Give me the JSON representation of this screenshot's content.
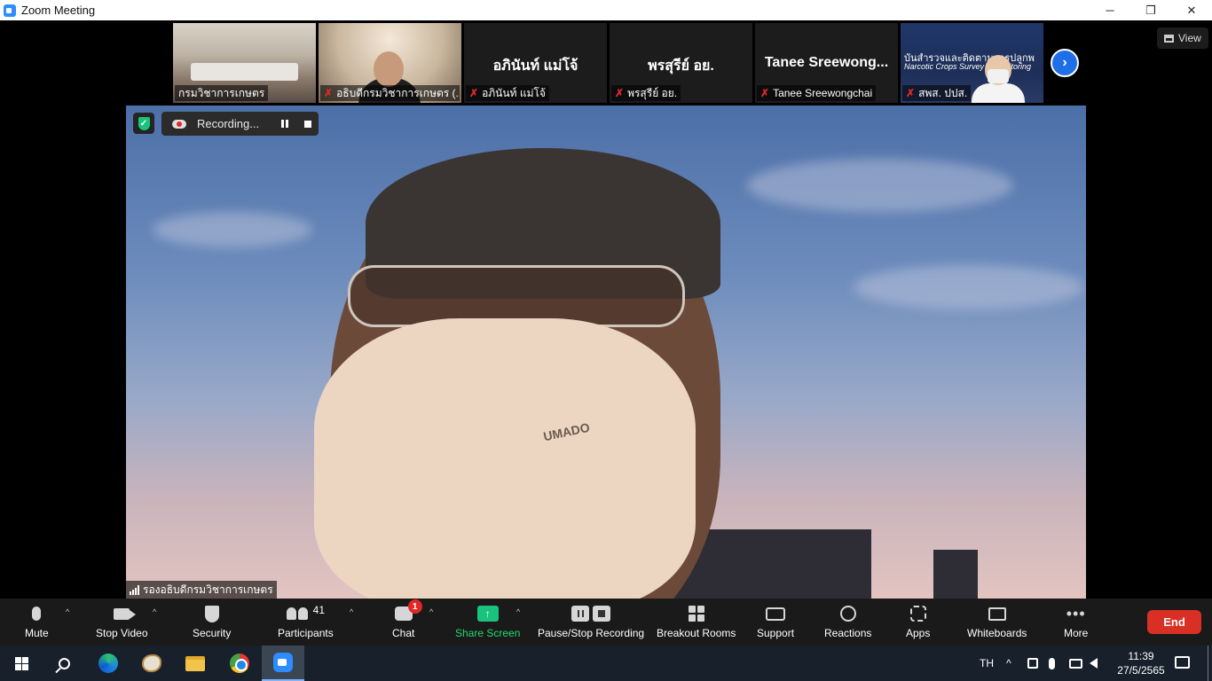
{
  "window": {
    "title": "Zoom Meeting",
    "controls": {
      "minimize": "─",
      "restore": "❐",
      "close": "✕"
    }
  },
  "top": {
    "view_label": "View",
    "participants_strip": [
      {
        "name": "กรมวิชาการเกษตร",
        "muted": false,
        "kind": "video-room"
      },
      {
        "name": "อธิบดีกรมวิชาการเกษตร (...",
        "muted": true,
        "kind": "video-person"
      },
      {
        "display": "อภินันท์ แม่โจ้",
        "name": "อภินันท์ แม่โจ้",
        "muted": true,
        "kind": "name-only"
      },
      {
        "display": "พรสุรีย์ อย.",
        "name": "พรสุรีย์ อย.",
        "muted": true,
        "kind": "name-only"
      },
      {
        "display": "Tanee  Sreewong...",
        "name": "Tanee Sreewongchai",
        "muted": true,
        "kind": "name-only"
      },
      {
        "name": "สพส. ปปส.",
        "muted": true,
        "kind": "video-office",
        "banner": "Narcotic Crops Survey & Monitoring",
        "heading": "บันสำรวจและติดตามการปลูกพ"
      }
    ],
    "next_icon": "›"
  },
  "main_video": {
    "recording_label": "Recording...",
    "speaker_name": "รองอธิบดีกรมวิชาการเกษตร",
    "mask_logo": "UMADO"
  },
  "toolbar": {
    "mute": "Mute",
    "stop_video": "Stop Video",
    "security": "Security",
    "participants": "Participants",
    "participants_count": "41",
    "chat": "Chat",
    "chat_badge": "1",
    "share_screen": "Share Screen",
    "pause_stop_recording": "Pause/Stop Recording",
    "breakout_rooms": "Breakout Rooms",
    "support": "Support",
    "reactions": "Reactions",
    "apps": "Apps",
    "whiteboards": "Whiteboards",
    "more": "More",
    "end": "End",
    "caret": "^",
    "share_arrow": "↑"
  },
  "taskbar": {
    "language": "TH",
    "time": "11:39",
    "date": "27/5/2565",
    "chevron": "^"
  },
  "colors": {
    "share_green": "#23d96e",
    "end_red": "#d93025",
    "zoom_blue": "#2d8cff",
    "mute_red": "#e02828"
  }
}
